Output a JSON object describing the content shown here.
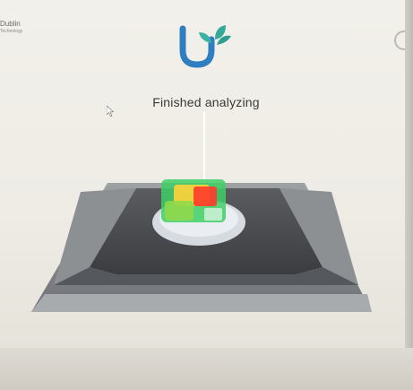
{
  "location": {
    "name": "Dublin",
    "subtitle": "Technology"
  },
  "logo": {
    "icon": "leaf-u-logo",
    "colors": {
      "u": "#2f7fc0",
      "leaves": "#35a99a"
    }
  },
  "status": {
    "text": "Finished analyzing"
  },
  "scan_view": {
    "icon": "3d-tray-scan",
    "highlight_colors": [
      "#ff3a2a",
      "#ffd23a",
      "#8ed84a",
      "#3fcf66"
    ]
  }
}
